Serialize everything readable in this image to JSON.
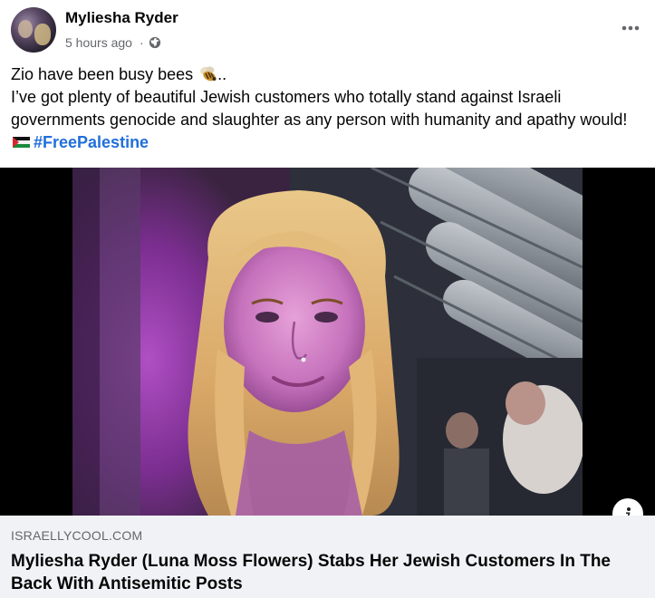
{
  "post": {
    "author_name": "Myliesha Ryder",
    "timestamp": "5 hours ago",
    "separator": "·",
    "privacy_icon": "globe-icon",
    "more_icon": "more-options-icon",
    "text": {
      "line1_prefix": "Zio have been busy bees",
      "line1_suffix": "..",
      "line2": "I’ve got plenty of beautiful Jewish customers who totally stand against Israeli governments genocide and slaughter as any person with humanity and apathy would!",
      "hashtag": "#FreePalestine"
    },
    "emoji": {
      "bee": "bee-icon",
      "flag": "palestine-flag-icon"
    }
  },
  "link_preview": {
    "domain": "ISRAELLYCOOL.COM",
    "title": "Myliesha Ryder (Luna Moss Flowers) Stabs Her Jewish Customers In The Back With Antisemitic Posts",
    "info_icon": "info-icon"
  },
  "colors": {
    "text_primary": "#050505",
    "text_secondary": "#65676b",
    "hashtag": "#216fdb",
    "caption_bg": "#f0f2f5"
  }
}
